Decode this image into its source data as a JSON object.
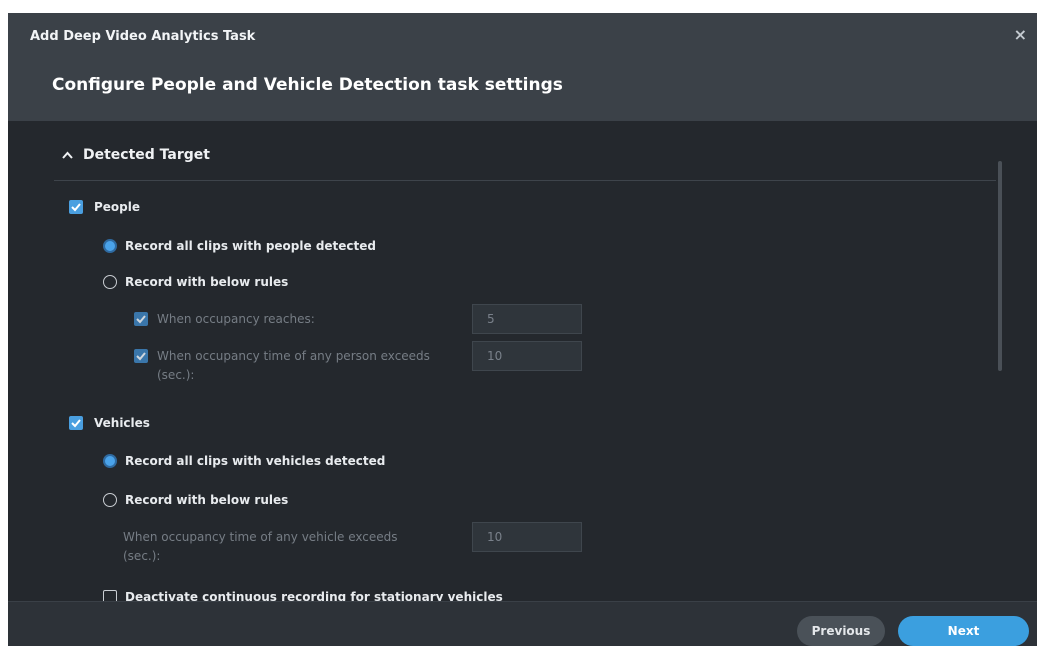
{
  "dialog": {
    "title": "Add Deep Video Analytics Task",
    "subtitle": "Configure People and Vehicle Detection task settings",
    "close": "×"
  },
  "section": {
    "title": "Detected Target",
    "expanded": true
  },
  "people": {
    "label": "People",
    "checked": true,
    "record_all": "Record all clips with people detected",
    "record_rules": "Record with below rules",
    "occupancy_reaches": {
      "label": "When occupancy reaches:",
      "value": "5",
      "checked": true
    },
    "occupancy_time": {
      "label_line1": "When occupancy time of any person exceeds",
      "label_line2": "(sec.):",
      "value": "10",
      "checked": true
    }
  },
  "vehicles": {
    "label": "Vehicles",
    "checked": true,
    "record_all": "Record all clips with vehicles detected",
    "record_rules": "Record with below rules",
    "occupancy_time": {
      "label_line1": "When occupancy time of any vehicle exceeds",
      "label_line2": "(sec.):",
      "value": "10"
    },
    "deactivate_stationary": {
      "label": "Deactivate continuous recording for stationary vehicles",
      "checked": false
    }
  },
  "footer": {
    "previous": "Previous",
    "next": "Next"
  },
  "colors": {
    "accent": "#3b9fdf",
    "background": "#24282d",
    "header": "#3b4148"
  }
}
